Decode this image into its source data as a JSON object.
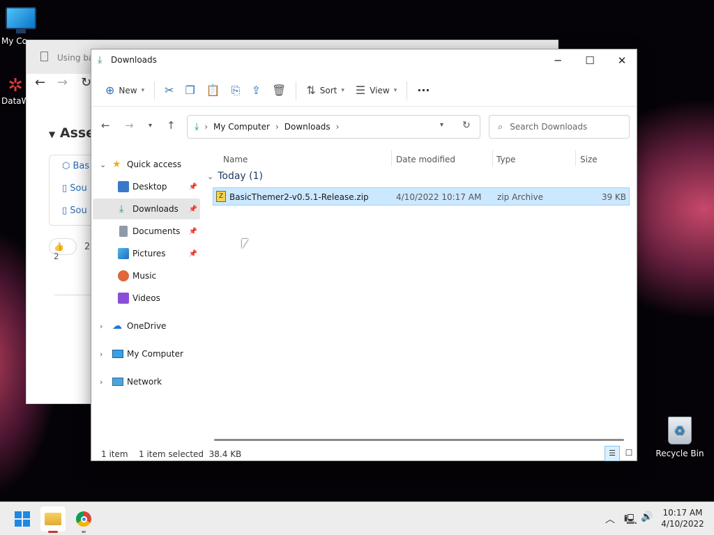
{
  "desktop": {
    "icons": [
      {
        "label": "My Co",
        "icon": "monitor-icon"
      },
      {
        "label": "DataW",
        "icon": "datawrangler-icon"
      },
      {
        "label": "Recycle Bin",
        "icon": "recycle-bin-icon"
      }
    ]
  },
  "background_window": {
    "tab_title": "Using bas",
    "section_title": "Asset",
    "cards": [
      "Bas",
      "Sou",
      "Sou"
    ],
    "reaction_count": "2",
    "other_count": "2"
  },
  "explorer": {
    "title": "Downloads",
    "commands": {
      "new": "New",
      "sort": "Sort",
      "view": "View",
      "more": "···"
    },
    "address": {
      "crumbs": [
        "My Computer",
        "Downloads"
      ]
    },
    "search": {
      "placeholder": "Search Downloads"
    },
    "sidebar": {
      "quick_access": "Quick access",
      "items": [
        {
          "label": "Desktop",
          "icon": "desktop-folder-icon",
          "color": "#3a78c9",
          "pinned": true
        },
        {
          "label": "Downloads",
          "icon": "downloads-folder-icon",
          "color": "#1f9d55",
          "pinned": true,
          "selected": true
        },
        {
          "label": "Documents",
          "icon": "documents-folder-icon",
          "color": "#8e9aa8",
          "pinned": true
        },
        {
          "label": "Pictures",
          "icon": "pictures-folder-icon",
          "color": "#2f8fd6",
          "pinned": true
        },
        {
          "label": "Music",
          "icon": "music-folder-icon",
          "color": "#e0663c",
          "pinned": false
        },
        {
          "label": "Videos",
          "icon": "videos-folder-icon",
          "color": "#8a4fd6",
          "pinned": false
        }
      ],
      "onedrive": "OneDrive",
      "my_computer": "My Computer",
      "network": "Network"
    },
    "columns": {
      "name": "Name",
      "date": "Date modified",
      "type": "Type",
      "size": "Size"
    },
    "group": {
      "label": "Today (1)"
    },
    "files": [
      {
        "name": "BasicThemer2-v0.5.1-Release.zip",
        "date": "4/10/2022 10:17 AM",
        "type": "zip Archive",
        "size": "39 KB"
      }
    ],
    "status": {
      "items": "1 item",
      "selected": "1 item selected  38.4 KB"
    }
  },
  "taskbar": {
    "time": "10:17 AM",
    "date": "4/10/2022"
  },
  "colors": {
    "accent": "#0078d4",
    "selection": "#cce8ff",
    "download_green": "#1f9d55"
  }
}
